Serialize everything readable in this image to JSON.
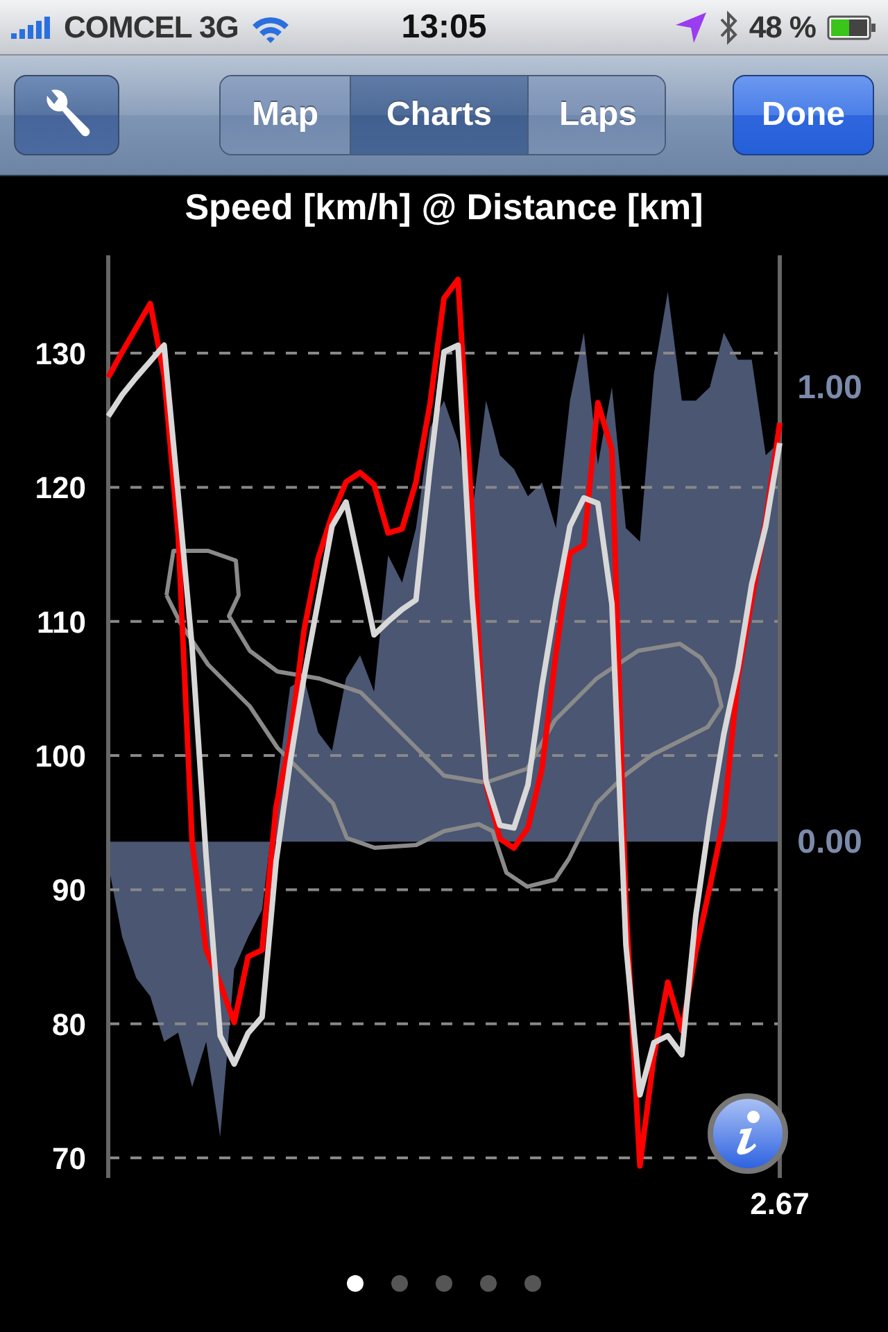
{
  "status_bar": {
    "carrier": "COMCEL 3G",
    "time": "13:05",
    "battery": "48 %"
  },
  "nav_bar": {
    "segments": [
      {
        "label": "Map",
        "selected": false
      },
      {
        "label": "Charts",
        "selected": true
      },
      {
        "label": "Laps",
        "selected": false
      }
    ],
    "done_button": "Done"
  },
  "chart": {
    "chart_data": {
      "type": "line",
      "title": "Speed [km/h] @ Distance [km]",
      "grid": true,
      "annotations": [
        {
          "text": "2.67"
        }
      ],
      "ylim": [
        68.5,
        137.3
      ],
      "yticks": [
        {
          "value": 70,
          "label": "70"
        },
        {
          "value": 80,
          "label": "80"
        },
        {
          "value": 90,
          "label": "90"
        },
        {
          "value": 100,
          "label": "100"
        },
        {
          "value": 110,
          "label": "110"
        },
        {
          "value": 120,
          "label": "120"
        },
        {
          "value": 130,
          "label": "130"
        }
      ],
      "y2lim": [
        -0.74,
        1.29
      ],
      "y2ticks": [
        {
          "value": 0,
          "label": "0.00"
        },
        {
          "value": 1,
          "label": "1.00"
        }
      ],
      "series": [
        {
          "type": "area",
          "axis": "y2",
          "color": "#4a5672",
          "values": [
            -0.05,
            -0.21,
            -0.3,
            -0.34,
            -0.44,
            -0.42,
            -0.54,
            -0.44,
            -0.65,
            -0.28,
            -0.21,
            -0.15,
            0.11,
            0.34,
            0.36,
            0.24,
            0.2,
            0.36,
            0.41,
            0.33,
            0.63,
            0.57,
            0.69,
            0.91,
            0.97,
            0.88,
            0.72,
            0.97,
            0.85,
            0.82,
            0.76,
            0.79,
            0.69,
            0.97,
            1.12,
            0.83,
            1.0,
            0.69,
            0.66,
            1.03,
            1.21,
            0.97,
            0.97,
            1.0,
            1.12,
            1.06,
            1.06,
            0.85,
            0.88
          ]
        },
        {
          "color": "#ff0000",
          "values": [
            128.2,
            130.1,
            131.9,
            133.7,
            128.3,
            116.5,
            93.5,
            85.5,
            83.0,
            80.1,
            85.0,
            85.5,
            96.2,
            101.1,
            109.4,
            114.7,
            117.9,
            120.4,
            121.1,
            120.2,
            116.6,
            116.9,
            120.4,
            126.2,
            134.1,
            135.5,
            118.1,
            97.9,
            93.8,
            93.1,
            94.6,
            99.0,
            107.6,
            115.1,
            115.7,
            126.3,
            122.8,
            88.9,
            69.4,
            77.6,
            83.1,
            79.5,
            85.4,
            90.2,
            95.3,
            105.8,
            111.6,
            117.5,
            124.8
          ]
        },
        {
          "color": "#d8d8d8",
          "values": [
            125.3,
            126.9,
            128.2,
            129.4,
            130.6,
            119.5,
            108.0,
            92.4,
            79.1,
            77.0,
            79.3,
            80.5,
            92.1,
            99.5,
            105.9,
            111.5,
            117.1,
            118.9,
            114.0,
            109.0,
            110.0,
            110.9,
            111.6,
            121.4,
            130.1,
            130.6,
            111.8,
            98.1,
            94.8,
            94.6,
            97.8,
            105.2,
            111.5,
            117.1,
            119.2,
            118.8,
            111.3,
            85.9,
            74.7,
            78.6,
            79.1,
            77.7,
            88.1,
            95.4,
            101.6,
            106.5,
            112.8,
            117.1,
            123.3
          ]
        }
      ]
    }
  },
  "page_dots": [
    {
      "selected": true
    },
    {
      "selected": false
    },
    {
      "selected": false
    },
    {
      "selected": false
    },
    {
      "selected": false
    }
  ]
}
